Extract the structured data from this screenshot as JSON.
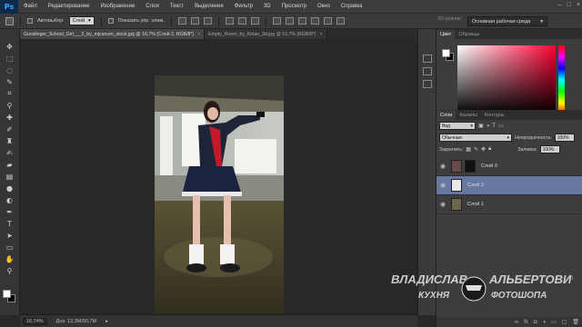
{
  "menubar": {
    "logo": "Ps",
    "items": [
      "Файл",
      "Редактирование",
      "Изображение",
      "Слои",
      "Текст",
      "Выделение",
      "Фильтр",
      "3D",
      "Просмотр",
      "Окно",
      "Справка"
    ],
    "window_controls": [
      "–",
      "□",
      "×"
    ]
  },
  "options": {
    "autoselect_label": "Автовыбор:",
    "autoselect_value": "Слой",
    "show_controls_label": "Показать упр. элем.",
    "mode3d_label": "3D-режим:",
    "workspace": "Основная рабочая среда"
  },
  "tabs": [
    {
      "label": "Gunslinger_School_Girl___2_by_mjcanum_stock.jpg @ 16,7% (Слой 2, RGB/8*)",
      "active": true
    },
    {
      "label": "Empty_Room_by_Kirlan_3d.jpg @ 16,7% (RGB/8*)",
      "active": false
    }
  ],
  "status": {
    "zoom": "16,74%",
    "doc": "Док: 13,3M/90,7M"
  },
  "color_panel": {
    "tabs": [
      "Цвет",
      "Образцы"
    ],
    "hue_hex": "#ff0032"
  },
  "layers_panel": {
    "tabs": [
      "Слои",
      "Каналы",
      "Контуры"
    ],
    "kind": "Вид",
    "blend_mode": "Обычные",
    "opacity_label": "Непрозрачность:",
    "opacity_value": "100%",
    "lock_label": "Закрепить:",
    "fill_label": "Заливка:",
    "fill_value": "100%",
    "layers": [
      {
        "name": "Слой 0",
        "selected": false
      },
      {
        "name": "Слой 2",
        "selected": true
      },
      {
        "name": "Слой 1",
        "selected": false
      }
    ],
    "footer_icons": [
      "link-icon",
      "fx-icon",
      "mask-icon",
      "adjustment-icon",
      "folder-icon",
      "new-layer-icon",
      "trash-icon"
    ]
  },
  "watermark": {
    "line1_left": "ВЛАДИСЛАВ",
    "line1_right": "АЛЬБЕРТОВИЧ",
    "line2_left": "КУХНЯ",
    "line2_right": "ФОТОШОПА"
  },
  "tools": [
    "move-tool-icon",
    "marquee-tool-icon",
    "lasso-tool-icon",
    "quick-select-tool-icon",
    "crop-tool-icon",
    "eyedropper-tool-icon",
    "healing-tool-icon",
    "brush-tool-icon",
    "stamp-tool-icon",
    "history-brush-tool-icon",
    "eraser-tool-icon",
    "gradient-tool-icon",
    "blur-tool-icon",
    "dodge-tool-icon",
    "pen-tool-icon",
    "text-tool-icon",
    "path-select-tool-icon",
    "shape-tool-icon",
    "hand-tool-icon",
    "zoom-tool-icon"
  ]
}
